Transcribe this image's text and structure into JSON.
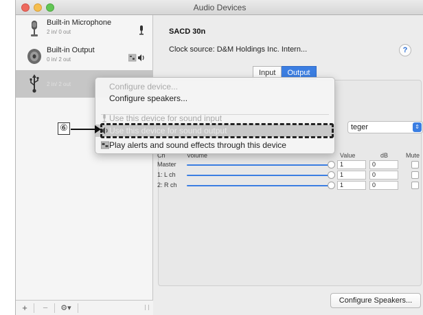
{
  "window": {
    "title": "Audio Devices"
  },
  "sidebar": {
    "devices": [
      {
        "name": "Built-in Microphone",
        "sub": "2 in/ 0 out",
        "icon": "microphone-icon",
        "right_icon": "mic-indicator-icon"
      },
      {
        "name": "Built-in Output",
        "sub": "0 in/ 2 out",
        "icon": "speaker-icon",
        "right_icon": "speaker-output-icon"
      },
      {
        "name": "",
        "sub": "2 in/ 2 out",
        "icon": "usb-icon",
        "selected": true
      }
    ],
    "footer": {
      "add": "+",
      "remove": "−",
      "gear": "⚙▾"
    }
  },
  "main": {
    "device_title": "SACD 30n",
    "clock_source": "Clock source: D&M Holdings Inc. Intern...",
    "help": "?",
    "tabs": [
      {
        "label": "Input"
      },
      {
        "label": "Output",
        "active": true
      }
    ],
    "format": "teger",
    "volume_headers": {
      "channel": "Ch",
      "volume": "Volume",
      "value": "Value",
      "db": "dB",
      "mute": "Mute"
    },
    "channels": [
      {
        "name": "Master",
        "value": "1",
        "db": "0"
      },
      {
        "name": "1: L ch",
        "value": "1",
        "db": "0"
      },
      {
        "name": "2: R ch",
        "value": "1",
        "db": "0"
      }
    ],
    "configure_speakers": "Configure Speakers..."
  },
  "context_menu": {
    "items": [
      {
        "label": "Configure device...",
        "state": "disabled"
      },
      {
        "label": "Configure speakers...",
        "state": "normal"
      },
      {
        "label": "Use this device for sound input",
        "state": "disabled"
      },
      {
        "label": "Use this device for sound output",
        "state": "highlight"
      },
      {
        "label": "Play alerts and sound effects through this device",
        "state": "normal"
      }
    ]
  },
  "callout": {
    "label": "⑥"
  },
  "colors": {
    "accent": "#3b7ee2",
    "highlight": "#c8c8c8"
  }
}
